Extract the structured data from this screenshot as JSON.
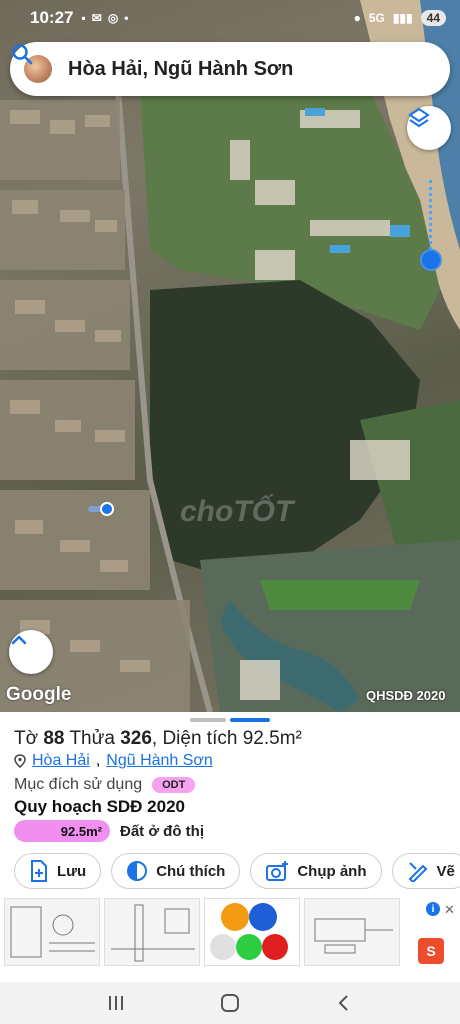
{
  "status_bar": {
    "time": "10:27",
    "signal": "5G",
    "battery": "44"
  },
  "search": {
    "location": "Hòa Hải, Ngũ Hành Sơn"
  },
  "map": {
    "watermark": "choTỐT",
    "google": "Google",
    "tag": "QHSDĐ 2020"
  },
  "parcel": {
    "to_label": "Tờ",
    "to_value": "88",
    "thua_label": "Thửa",
    "thua_value": "326",
    "area_label": "Diện tích",
    "area_value": "92.5m²",
    "ward": "Hòa Hải",
    "district": "Ngũ Hành Sơn",
    "purpose_label": "Mục đích sử dụng",
    "purpose_code": "ODT",
    "plan_title": "Quy hoạch SDĐ 2020",
    "plan_area": "92.5m²",
    "plan_type": "Đất ở đô thị"
  },
  "actions": [
    {
      "label": "Lưu",
      "icon": "add-file-icon"
    },
    {
      "label": "Chú thích",
      "icon": "half-circle-icon"
    },
    {
      "label": "Chụp ảnh",
      "icon": "camera-icon"
    },
    {
      "label": "Vẽ",
      "icon": "draw-icon"
    }
  ],
  "ad": {
    "info": "i",
    "close": "✕",
    "brand_letter": "S"
  },
  "colors": {
    "accent": "#1a73e8",
    "pink": "#f08ff0"
  }
}
